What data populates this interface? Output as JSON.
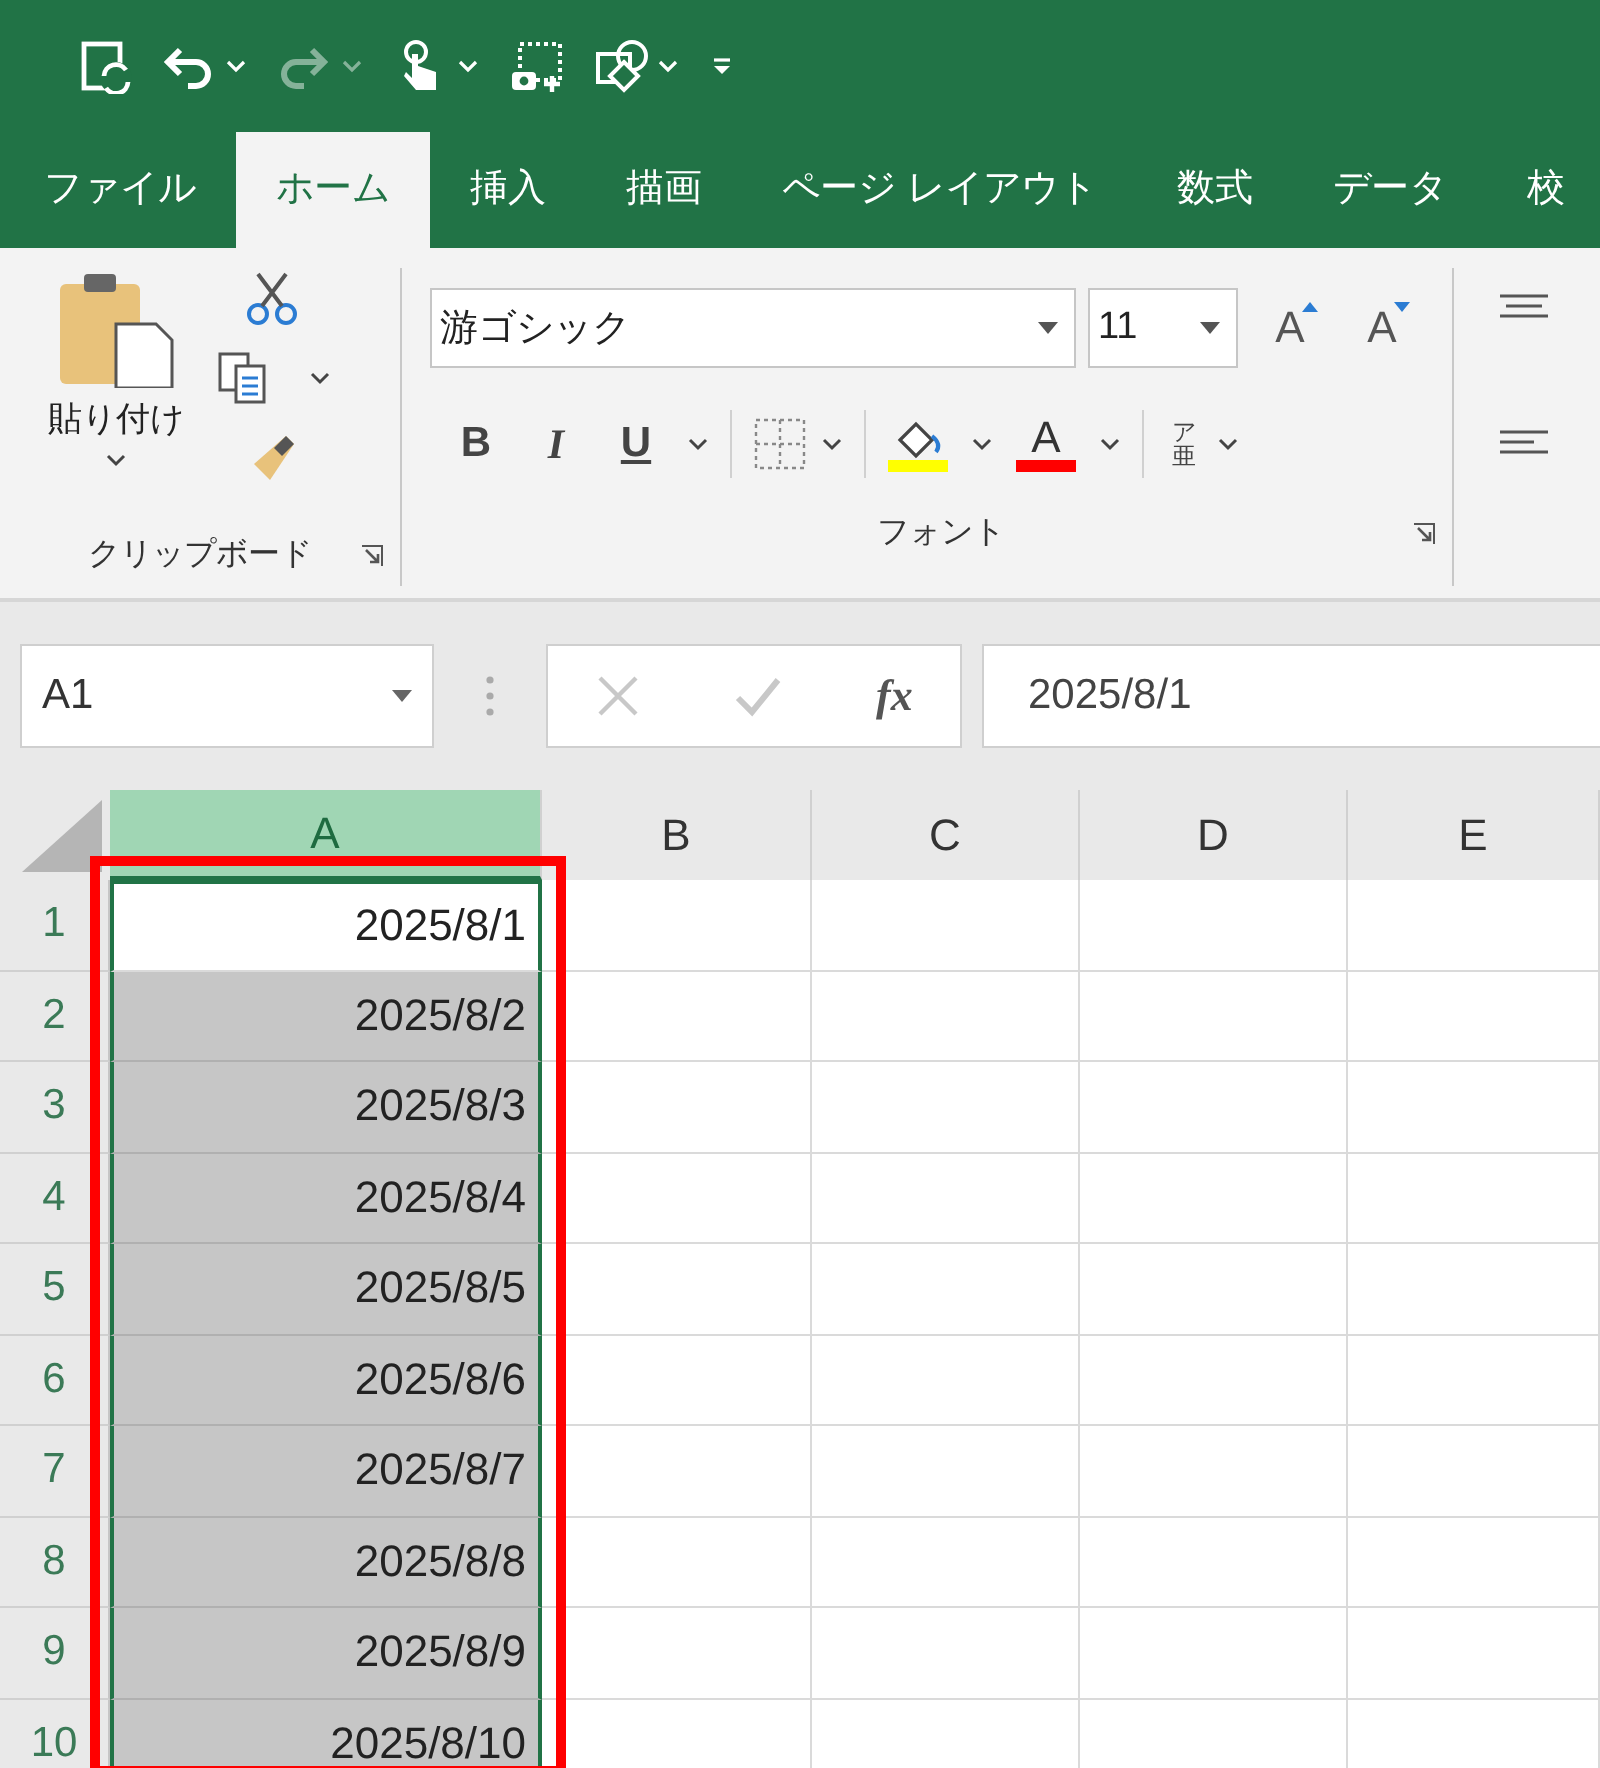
{
  "quick_access": [
    {
      "kind": "autosave",
      "dropdown": false,
      "disabled": false
    },
    {
      "kind": "undo",
      "dropdown": true,
      "disabled": false
    },
    {
      "kind": "redo",
      "dropdown": true,
      "disabled": true
    },
    {
      "kind": "touch",
      "dropdown": true,
      "disabled": false
    },
    {
      "kind": "screenshot",
      "dropdown": false,
      "disabled": false
    },
    {
      "kind": "shapes",
      "dropdown": true,
      "disabled": false
    },
    {
      "kind": "customize",
      "dropdown": false,
      "disabled": false
    }
  ],
  "tabs": [
    {
      "label": "ファイル",
      "selected": false
    },
    {
      "label": "ホーム",
      "selected": true
    },
    {
      "label": "挿入",
      "selected": false
    },
    {
      "label": "描画",
      "selected": false
    },
    {
      "label": "ページ レイアウト",
      "selected": false
    },
    {
      "label": "数式",
      "selected": false
    },
    {
      "label": "データ",
      "selected": false
    },
    {
      "label": "校",
      "selected": false
    }
  ],
  "clipboard": {
    "label": "クリップボード",
    "paste_label": "貼り付け"
  },
  "font": {
    "label": "フォント",
    "font_name": "游ゴシック",
    "font_size": "11",
    "grow_label": "A",
    "shrink_label": "A",
    "bold_label": "B",
    "italic_label": "I",
    "underline_label": "U",
    "font_color_label": "A",
    "phonetic_label": "ア亜"
  },
  "formula_bar": {
    "name_box": "A1",
    "function_label": "fx",
    "formula": "2025/8/1"
  },
  "columns": [
    {
      "label": "A",
      "selected": true
    },
    {
      "label": "B",
      "selected": false
    },
    {
      "label": "C",
      "selected": false
    },
    {
      "label": "D",
      "selected": false
    },
    {
      "label": "E",
      "selected": false
    }
  ],
  "rows": [
    {
      "header": "1",
      "selected": true,
      "value": "2025/8/1",
      "active": true
    },
    {
      "header": "2",
      "selected": true,
      "value": "2025/8/2",
      "active": false
    },
    {
      "header": "3",
      "selected": true,
      "value": "2025/8/3",
      "active": false
    },
    {
      "header": "4",
      "selected": true,
      "value": "2025/8/4",
      "active": false
    },
    {
      "header": "5",
      "selected": true,
      "value": "2025/8/5",
      "active": false
    },
    {
      "header": "6",
      "selected": true,
      "value": "2025/8/6",
      "active": false
    },
    {
      "header": "7",
      "selected": true,
      "value": "2025/8/7",
      "active": false
    },
    {
      "header": "8",
      "selected": true,
      "value": "2025/8/8",
      "active": false
    },
    {
      "header": "9",
      "selected": true,
      "value": "2025/8/9",
      "active": false
    },
    {
      "header": "10",
      "selected": true,
      "value": "2025/8/10",
      "active": false
    }
  ],
  "highlight_frame": true
}
